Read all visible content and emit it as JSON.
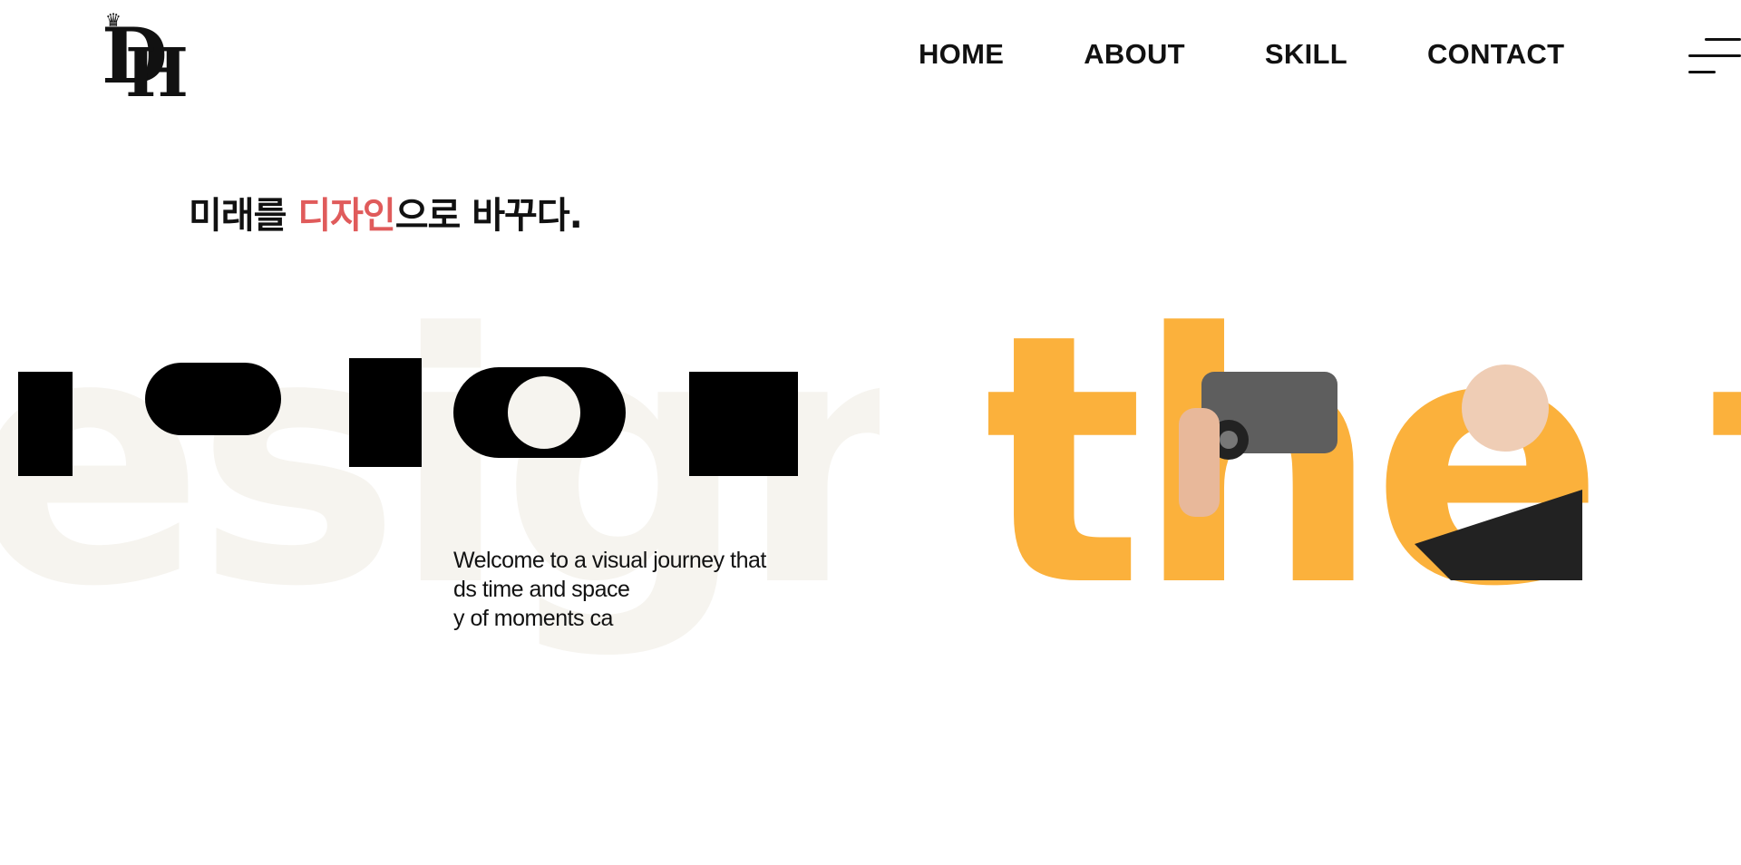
{
  "header": {
    "logo_text": "DH",
    "nav": [
      {
        "label": "HOME"
      },
      {
        "label": "ABOUT"
      },
      {
        "label": "SKILL"
      },
      {
        "label": "CONTACT"
      }
    ],
    "menu_icon": "hamburger-icon"
  },
  "hero": {
    "tagline_prefix": "미래를 ",
    "tagline_accent": "디자인",
    "tagline_suffix": "으로 바꾸다.",
    "headline": "esign the f",
    "intro_lines": [
      "Welcome to a visual journey that",
      "ds time and space",
      "y of moments ca"
    ]
  },
  "colors": {
    "accent": "#e05b5b",
    "hero_fill": "#f6f4ef",
    "hero_yellow": "#fbb13c",
    "text": "#111111"
  }
}
